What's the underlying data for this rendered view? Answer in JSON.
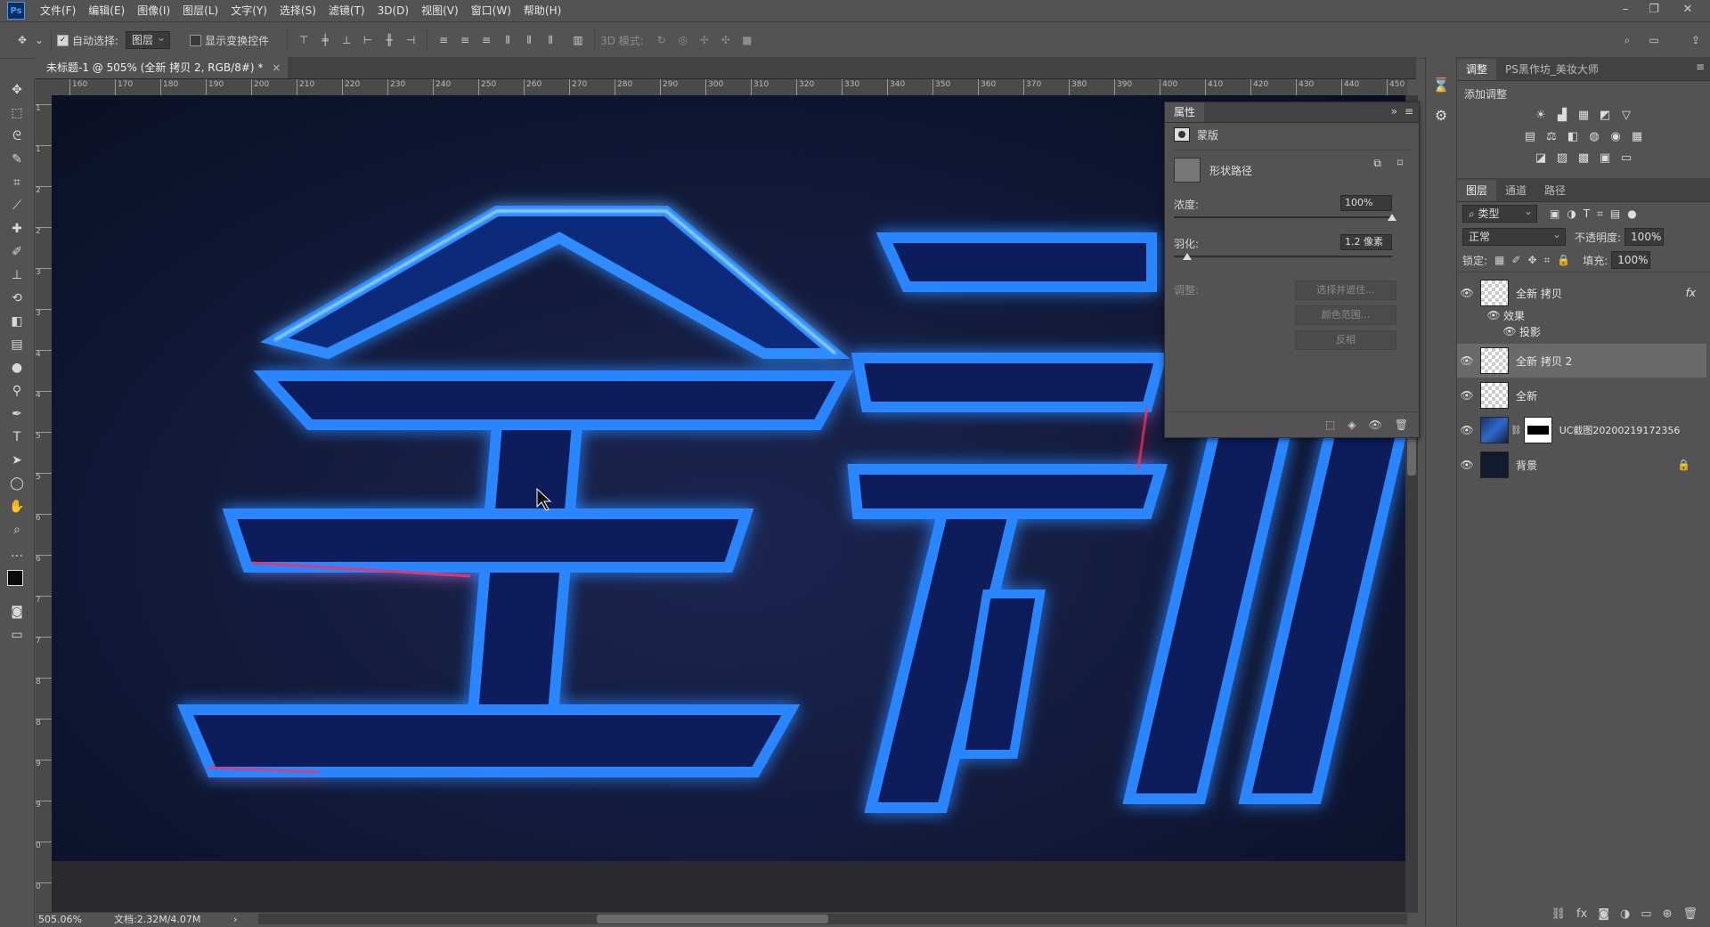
{
  "app": {
    "logo": "Ps"
  },
  "menu": [
    "文件(F)",
    "编辑(E)",
    "图像(I)",
    "图层(L)",
    "文字(Y)",
    "选择(S)",
    "滤镜(T)",
    "3D(D)",
    "视图(V)",
    "窗口(W)",
    "帮助(H)"
  ],
  "window_controls": {
    "minimize": "–",
    "restore": "❐",
    "close": "✕"
  },
  "options": {
    "auto_select_label": "自动选择:",
    "auto_select_checked": true,
    "auto_select_value": "图层",
    "show_transform_label": "显示变换控件",
    "mode_label": "3D 模式:"
  },
  "document": {
    "tab_title": "未标题-1 @ 505% (全新 拷贝 2, RGB/8#) *",
    "close": "×"
  },
  "ruler": {
    "h_labels": [
      "160",
      "170",
      "180",
      "190",
      "200",
      "210",
      "220",
      "230",
      "240",
      "250",
      "260",
      "270",
      "280",
      "290",
      "300",
      "310",
      "320",
      "330",
      "340",
      "350",
      "360",
      "370",
      "380",
      "390",
      "400",
      "410",
      "420",
      "430",
      "440",
      "450"
    ],
    "v_labels": [
      "1",
      "1",
      "2",
      "2",
      "3",
      "3",
      "4",
      "4",
      "5",
      "5",
      "6",
      "6",
      "7",
      "7",
      "8",
      "8",
      "9",
      "9",
      "0",
      "0"
    ]
  },
  "canvas": {
    "text": "全新",
    "bg_color": "#0e1530",
    "glow_color": "#1f6bff",
    "edge_color": "#7fd4ff"
  },
  "status": {
    "zoom": "505.06%",
    "doc": "文档:2.32M/4.07M",
    "arrow": "›"
  },
  "properties": {
    "tab": "属性",
    "mask_label": "蒙版",
    "shape_path_label": "形状路径",
    "density_label": "浓度:",
    "density_value": "100%",
    "density_fraction": 1.0,
    "feather_label": "羽化:",
    "feather_value": "1.2 像素",
    "adjust_label": "调整:",
    "btn_select_mask": "选择并遮住...",
    "btn_color_range": "颜色范围...",
    "btn_invert": "反相"
  },
  "right_panel": {
    "top_tabs": [
      "调整",
      "PS黑作坊_美妆大师"
    ],
    "add_adjustment": "添加调整",
    "layer_tabs": [
      "图层",
      "通道",
      "路径"
    ],
    "kind_filter": "类型",
    "blend_mode": "正常",
    "opacity_label": "不透明度:",
    "opacity_value": "100%",
    "lock_label": "锁定:",
    "fill_label": "填充:",
    "fill_value": "100%",
    "fx_badge": "fx",
    "effects_label": "效果",
    "drop_shadow_label": "投影",
    "layers": [
      {
        "name": "全新 拷贝",
        "selected": false
      },
      {
        "name": "全新 拷贝 2",
        "selected": true
      },
      {
        "name": "全新",
        "selected": false
      },
      {
        "name": "UC截图20200219172356",
        "selected": false
      },
      {
        "name": "背景",
        "selected": false
      }
    ]
  }
}
